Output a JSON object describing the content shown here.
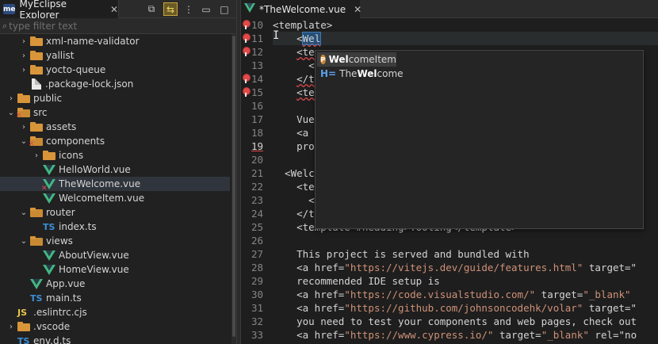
{
  "explorer": {
    "title": "MyEclipse Explorer",
    "logo": "me",
    "filter_placeholder": "type filter text",
    "tree": [
      {
        "label": "xml-name-validator",
        "type": "folder",
        "depth": 2,
        "expanded": false
      },
      {
        "label": "yallist",
        "type": "folder",
        "depth": 2,
        "expanded": false
      },
      {
        "label": "yocto-queue",
        "type": "folder",
        "depth": 2,
        "expanded": false
      },
      {
        "label": ".package-lock.json",
        "type": "file",
        "depth": 2
      },
      {
        "label": "public",
        "type": "folder",
        "depth": 1,
        "expanded": false
      },
      {
        "label": "src",
        "type": "folder",
        "depth": 1,
        "expanded": true,
        "error": true
      },
      {
        "label": "assets",
        "type": "folder",
        "depth": 2,
        "expanded": false
      },
      {
        "label": "components",
        "type": "folder",
        "depth": 2,
        "expanded": true,
        "error": true
      },
      {
        "label": "icons",
        "type": "folder",
        "depth": 3,
        "expanded": false
      },
      {
        "label": "HelloWorld.vue",
        "type": "vue",
        "depth": 3
      },
      {
        "label": "TheWelcome.vue",
        "type": "vue",
        "depth": 3,
        "error": true,
        "selected": true
      },
      {
        "label": "WelcomeItem.vue",
        "type": "vue",
        "depth": 3
      },
      {
        "label": "router",
        "type": "folder",
        "depth": 2,
        "expanded": true
      },
      {
        "label": "index.ts",
        "type": "ts",
        "depth": 3
      },
      {
        "label": "views",
        "type": "folder",
        "depth": 2,
        "expanded": true
      },
      {
        "label": "AboutView.vue",
        "type": "vue",
        "depth": 3
      },
      {
        "label": "HomeView.vue",
        "type": "vue",
        "depth": 3
      },
      {
        "label": "App.vue",
        "type": "vue",
        "depth": 2
      },
      {
        "label": "main.ts",
        "type": "ts",
        "depth": 2
      },
      {
        "label": ".eslintrc.cjs",
        "type": "js",
        "depth": 1
      },
      {
        "label": ".vscode",
        "type": "folder",
        "depth": 1,
        "expanded": false
      },
      {
        "label": "env.d.ts",
        "type": "ts",
        "depth": 1
      }
    ]
  },
  "editor": {
    "tab_title": "*TheWelcome.vue",
    "lines": [
      {
        "n": "10",
        "marker": true,
        "text": "<template>"
      },
      {
        "n": "11",
        "marker": true,
        "current": true,
        "text": "    <Wel"
      },
      {
        "n": "12",
        "marker": true,
        "text": "    <te"
      },
      {
        "n": "13",
        "text": "      <"
      },
      {
        "n": "14",
        "marker": true,
        "text": "    </t"
      },
      {
        "n": "15",
        "marker": true,
        "text": "    <te"
      },
      {
        "n": "16",
        "text": ""
      },
      {
        "n": "17",
        "text": "    Vue"
      },
      {
        "n": "18",
        "text": "    <a                                         ene"
      },
      {
        "n": "19",
        "error": true,
        "text": "    pro                                        sed"
      },
      {
        "n": "20",
        "text": ""
      },
      {
        "n": "21",
        "text": "  <Welc"
      },
      {
        "n": "22",
        "text": "    <te"
      },
      {
        "n": "23",
        "text": "      <"
      },
      {
        "n": "24",
        "text": "    </t"
      },
      {
        "n": "25",
        "text": "    <template #heading>Tooling</template>"
      },
      {
        "n": "26",
        "text": ""
      },
      {
        "n": "27",
        "text": "    This project is served and bundled with"
      },
      {
        "n": "28",
        "text": "    <a href=\"https://vitejs.dev/guide/features.html\" target=\""
      },
      {
        "n": "29",
        "text": "    recommended IDE setup is"
      },
      {
        "n": "30",
        "text": "    <a href=\"https://code.visualstudio.com/\" target=\"_blank\""
      },
      {
        "n": "31",
        "text": "    <a href=\"https://github.com/johnsoncodehk/volar\" target=\""
      },
      {
        "n": "32",
        "text": "    you need to test your components and web pages, check out"
      },
      {
        "n": "33",
        "text": "    <a href=\"https://www.cypress.io/\" target=\"_blank\" rel=\"no"
      }
    ],
    "autocomplete": {
      "items": [
        {
          "icon": "property-icon",
          "match": "Wel",
          "rest": "comeItem",
          "selected": true
        },
        {
          "icon": "html-tag-icon",
          "prefix": "The",
          "match": "Wel",
          "rest": "come",
          "selected": false
        }
      ]
    }
  },
  "colors": {
    "background": "#1e1e1e",
    "sidebar": "#212121",
    "folder": "#d8953a",
    "vue": "#41b883",
    "ts": "#3b8fd9",
    "js": "#e8c64b",
    "error": "#e04a4a",
    "string": "#ce9178",
    "selection": "#264f78"
  }
}
